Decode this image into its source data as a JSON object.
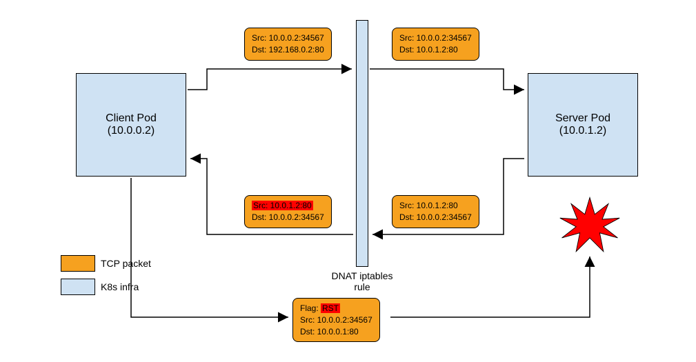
{
  "client_pod": {
    "title": "Client Pod",
    "ip": "(10.0.0.2)"
  },
  "server_pod": {
    "title": "Server Pod",
    "ip": "(10.0.1.2)"
  },
  "nat_label": "DNAT iptables rule",
  "packets": {
    "top_left": {
      "src": "Src: 10.0.0.2:34567",
      "dst": "Dst: 192.168.0.2:80"
    },
    "top_right": {
      "src": "Src: 10.0.0.2:34567",
      "dst": "Dst: 10.0.1.2:80"
    },
    "mid_left": {
      "src": "Src: 10.0.1.2:80",
      "dst": "Dst: 10.0.0.2:34567"
    },
    "mid_right": {
      "src": "Src: 10.0.1.2:80",
      "dst": "Dst: 10.0.0.2:34567"
    },
    "rst": {
      "flag_label": "Flag: ",
      "flag": "RST",
      "src": "Src: 10.0.0.2:34567",
      "dst": "Dst: 10.0.0.1:80"
    }
  },
  "legend": {
    "packet": "TCP packet",
    "infra": "K8s infra"
  }
}
